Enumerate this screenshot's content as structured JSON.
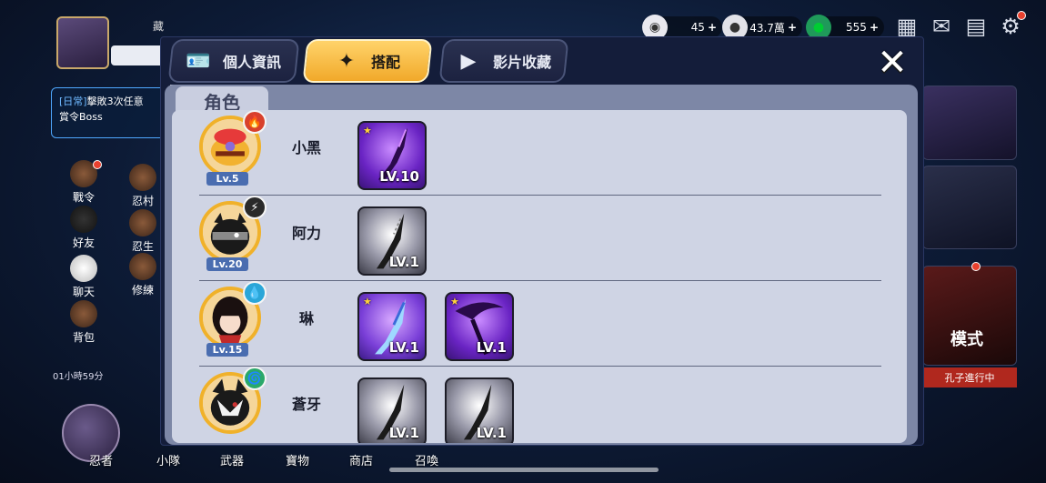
{
  "hud": {
    "player_name": "藏",
    "resources": [
      {
        "name": "stamina",
        "value": "45",
        "icon": "ghost-icon"
      },
      {
        "name": "coins",
        "value": "43.7萬",
        "icon": "coin-icon"
      },
      {
        "name": "gems",
        "value": "555",
        "icon": "soul-gem-icon"
      }
    ],
    "top_icons": [
      "calendar-icon",
      "mail-icon",
      "notice-board-icon",
      "settings-gear-icon"
    ],
    "quest": {
      "tag": "[日常]",
      "text": "擊敗3次任意",
      "text2": "賞令Boss"
    },
    "side_menu": [
      {
        "label": "戰令",
        "dot": true
      },
      {
        "label": "忍村",
        "dot": false
      },
      {
        "label": "好友",
        "dot": false
      },
      {
        "label": "忍生",
        "dot": false
      },
      {
        "label": "聊天",
        "dot": false
      },
      {
        "label": "修練",
        "dot": false
      },
      {
        "label": "背包",
        "dot": false
      }
    ],
    "timer": "01小時59分",
    "bottom_nav": [
      "忍者",
      "小隊",
      "武器",
      "寶物",
      "商店",
      "召喚"
    ],
    "right_panel": {
      "banner_text": "孔子進行中",
      "mode_text": "模式"
    }
  },
  "modal": {
    "tabs": [
      {
        "label": "個人資訊",
        "icon": "profile-card-icon",
        "active": false
      },
      {
        "label": "搭配",
        "icon": "shuriken-icon",
        "active": true
      },
      {
        "label": "影片收藏",
        "icon": "play-icon",
        "active": false
      }
    ],
    "close_label": "✕",
    "section_title": "角色",
    "characters": [
      {
        "name": "小黑",
        "level": "Lv.5",
        "element": "fire",
        "element_color": "#d8402c",
        "element_glyph": "🔥",
        "weapons": [
          {
            "level": "LV.10",
            "rarity": "purple",
            "star": true
          }
        ]
      },
      {
        "name": "阿力",
        "level": "Lv.20",
        "element": "lightning",
        "element_color": "#d8a82c",
        "element_glyph": "⚡",
        "weapons": [
          {
            "level": "LV.1",
            "rarity": "gray",
            "star": false
          }
        ]
      },
      {
        "name": "琳",
        "level": "Lv.15",
        "element": "water",
        "element_color": "#2aa6d8",
        "element_glyph": "💧",
        "weapons": [
          {
            "level": "LV.1",
            "rarity": "blue",
            "star": true
          },
          {
            "level": "LV.1",
            "rarity": "purple",
            "star": true
          }
        ]
      },
      {
        "name": "蒼牙",
        "level": "",
        "element": "wind",
        "element_color": "#2aa86a",
        "element_glyph": "🌀",
        "weapons": [
          {
            "level": "LV.1",
            "rarity": "gray",
            "star": false
          },
          {
            "level": "LV.1",
            "rarity": "gray",
            "star": false
          }
        ]
      }
    ]
  }
}
